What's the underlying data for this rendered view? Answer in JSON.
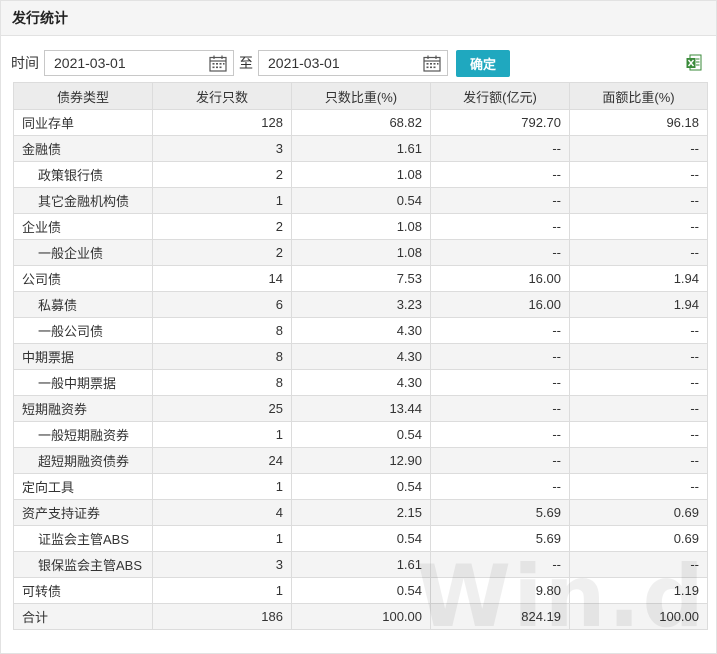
{
  "panel": {
    "title": "发行统计"
  },
  "filter": {
    "time_label": "时间",
    "start_date": "2021-03-01",
    "to_label": "至",
    "end_date": "2021-03-01",
    "confirm_label": "确定"
  },
  "icons": {
    "calendar": "calendar-icon",
    "export": "excel-export-icon"
  },
  "colors": {
    "accent": "#1fa8bf",
    "header_bg": "#ececec",
    "alt_row": "#f4f4f4"
  },
  "table": {
    "headers": [
      "债券类型",
      "发行只数",
      "只数比重(%)",
      "发行额(亿元)",
      "面额比重(%)"
    ],
    "rows": [
      {
        "name": "同业存单",
        "count": "128",
        "count_pct": "68.82",
        "amount": "792.70",
        "amount_pct": "96.18",
        "sub": false
      },
      {
        "name": "金融债",
        "count": "3",
        "count_pct": "1.61",
        "amount": "--",
        "amount_pct": "--",
        "sub": false
      },
      {
        "name": "政策银行债",
        "count": "2",
        "count_pct": "1.08",
        "amount": "--",
        "amount_pct": "--",
        "sub": true
      },
      {
        "name": "其它金融机构债",
        "count": "1",
        "count_pct": "0.54",
        "amount": "--",
        "amount_pct": "--",
        "sub": true
      },
      {
        "name": "企业债",
        "count": "2",
        "count_pct": "1.08",
        "amount": "--",
        "amount_pct": "--",
        "sub": false
      },
      {
        "name": "一般企业债",
        "count": "2",
        "count_pct": "1.08",
        "amount": "--",
        "amount_pct": "--",
        "sub": true
      },
      {
        "name": "公司债",
        "count": "14",
        "count_pct": "7.53",
        "amount": "16.00",
        "amount_pct": "1.94",
        "sub": false
      },
      {
        "name": "私募债",
        "count": "6",
        "count_pct": "3.23",
        "amount": "16.00",
        "amount_pct": "1.94",
        "sub": true
      },
      {
        "name": "一般公司债",
        "count": "8",
        "count_pct": "4.30",
        "amount": "--",
        "amount_pct": "--",
        "sub": true
      },
      {
        "name": "中期票据",
        "count": "8",
        "count_pct": "4.30",
        "amount": "--",
        "amount_pct": "--",
        "sub": false
      },
      {
        "name": "一般中期票据",
        "count": "8",
        "count_pct": "4.30",
        "amount": "--",
        "amount_pct": "--",
        "sub": true
      },
      {
        "name": "短期融资券",
        "count": "25",
        "count_pct": "13.44",
        "amount": "--",
        "amount_pct": "--",
        "sub": false
      },
      {
        "name": "一般短期融资券",
        "count": "1",
        "count_pct": "0.54",
        "amount": "--",
        "amount_pct": "--",
        "sub": true
      },
      {
        "name": "超短期融资债券",
        "count": "24",
        "count_pct": "12.90",
        "amount": "--",
        "amount_pct": "--",
        "sub": true
      },
      {
        "name": "定向工具",
        "count": "1",
        "count_pct": "0.54",
        "amount": "--",
        "amount_pct": "--",
        "sub": false
      },
      {
        "name": "资产支持证券",
        "count": "4",
        "count_pct": "2.15",
        "amount": "5.69",
        "amount_pct": "0.69",
        "sub": false
      },
      {
        "name": "证监会主管ABS",
        "count": "1",
        "count_pct": "0.54",
        "amount": "5.69",
        "amount_pct": "0.69",
        "sub": true
      },
      {
        "name": "银保监会主管ABS",
        "count": "3",
        "count_pct": "1.61",
        "amount": "--",
        "amount_pct": "--",
        "sub": true
      },
      {
        "name": "可转债",
        "count": "1",
        "count_pct": "0.54",
        "amount": "9.80",
        "amount_pct": "1.19",
        "sub": false
      },
      {
        "name": "合计",
        "count": "186",
        "count_pct": "100.00",
        "amount": "824.19",
        "amount_pct": "100.00",
        "sub": false
      }
    ]
  },
  "watermark": "Win.d"
}
